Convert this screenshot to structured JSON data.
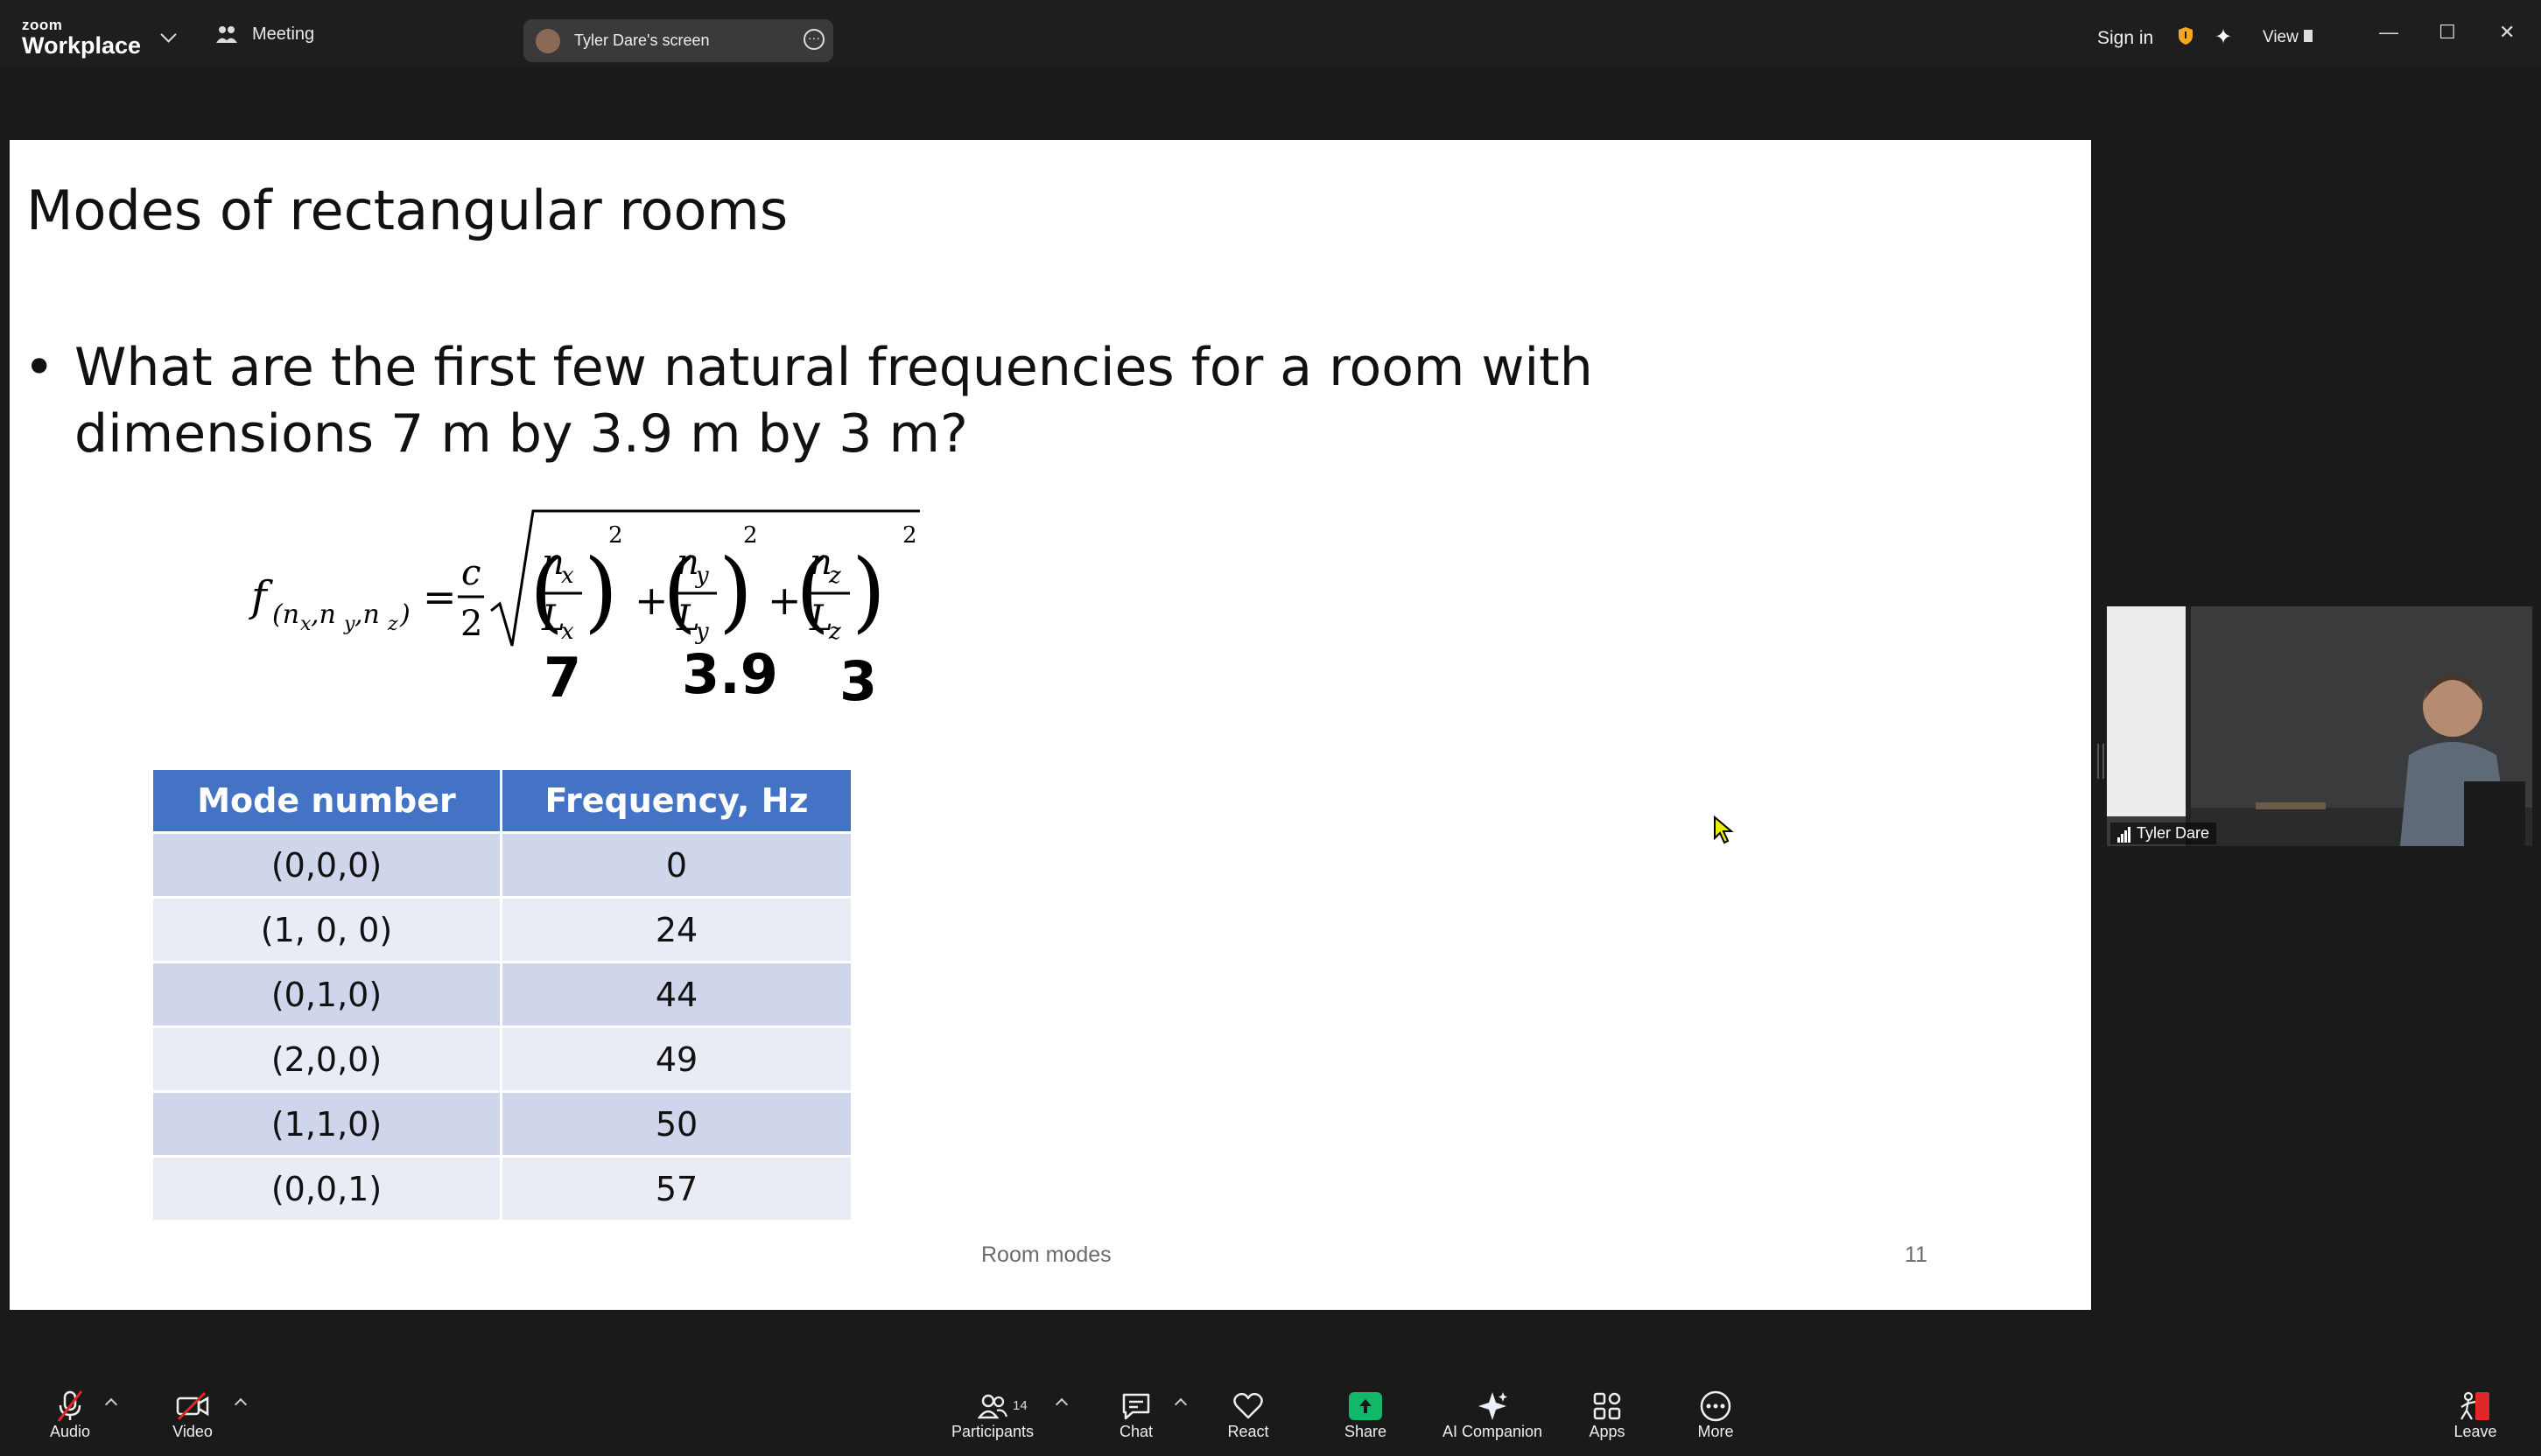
{
  "app": {
    "logo_small": "zoom",
    "logo_big": "Workplace",
    "meeting_label": "Meeting",
    "screen_share_label": "Tyler Dare's screen",
    "sign_in": "Sign in",
    "view": "View"
  },
  "slide": {
    "title": "Modes of rectangular rooms",
    "bullet": "What are the first few natural frequencies for a room with dimensions 7 m by 3.9 m by 3 m?",
    "handwritten": [
      "7",
      "3.9",
      "3"
    ],
    "table": {
      "headers": [
        "Mode number",
        "Frequency, Hz"
      ],
      "rows": [
        [
          "(0,0,0)",
          "0"
        ],
        [
          "(1, 0, 0)",
          "24"
        ],
        [
          "(0,1,0)",
          "44"
        ],
        [
          "(2,0,0)",
          "49"
        ],
        [
          "(1,1,0)",
          "50"
        ],
        [
          "(0,0,1)",
          "57"
        ]
      ]
    },
    "footer": "Room modes",
    "page_number": "11"
  },
  "participant": {
    "name": "Tyler Dare"
  },
  "toolbar": {
    "audio": "Audio",
    "video": "Video",
    "participants": "Participants",
    "participants_count": "14",
    "chat": "Chat",
    "react": "React",
    "share": "Share",
    "ai_companion": "AI Companion",
    "apps": "Apps",
    "more": "More",
    "leave": "Leave"
  },
  "colors": {
    "table_header": "#4472c4",
    "table_row_dark": "#cfd5ea",
    "table_row_light": "#e9ebf5",
    "share_green": "#12b76a",
    "leave_red": "#e02828"
  }
}
